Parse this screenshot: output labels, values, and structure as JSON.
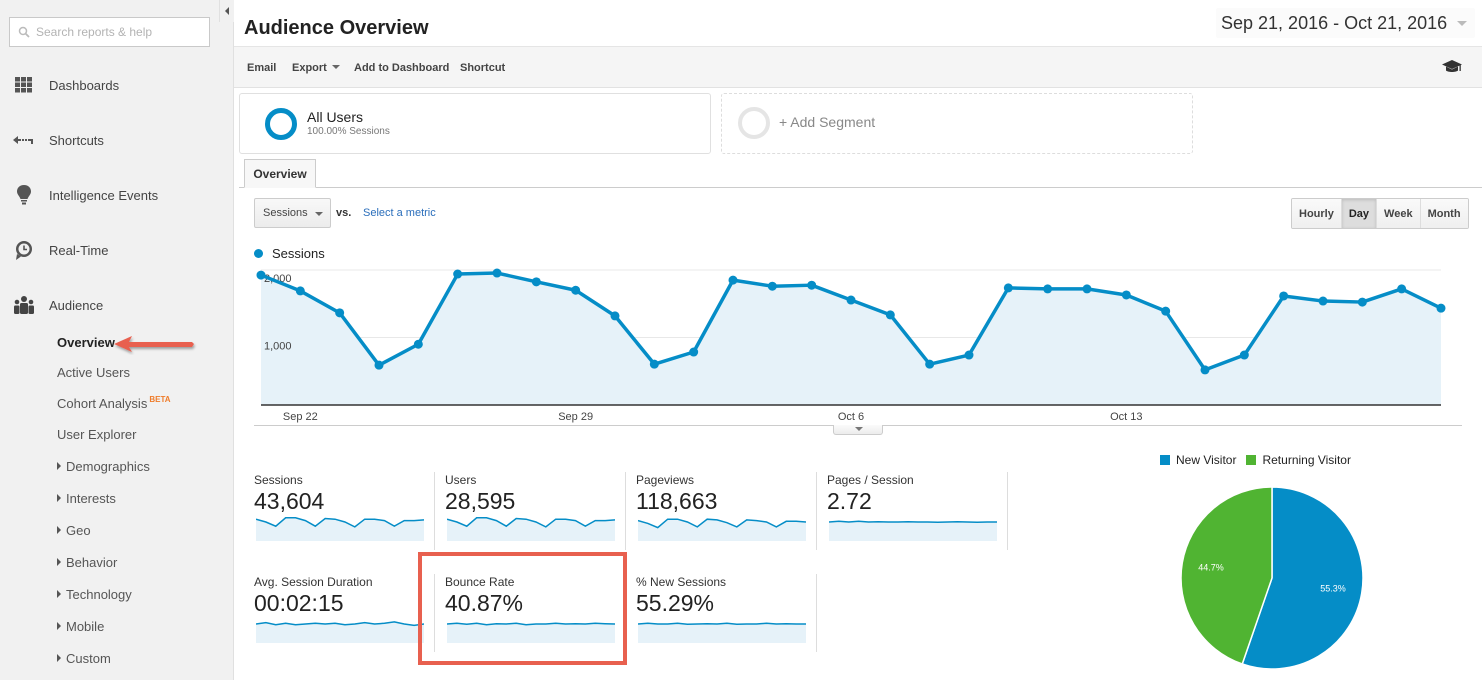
{
  "sidebar": {
    "search_placeholder": "Search reports & help",
    "nav": [
      {
        "label": "Dashboards",
        "icon": "dashboard-grid-icon"
      },
      {
        "label": "Shortcuts",
        "icon": "shortcut-arrow-icon"
      },
      {
        "label": "Intelligence Events",
        "icon": "lightbulb-icon"
      },
      {
        "label": "Real-Time",
        "icon": "clock-icon"
      },
      {
        "label": "Audience",
        "icon": "people-icon"
      }
    ],
    "audience_sub": [
      {
        "label": "Overview",
        "active": true,
        "expandable": false
      },
      {
        "label": "Active Users",
        "expandable": false
      },
      {
        "label": "Cohort Analysis",
        "badge": "BETA",
        "expandable": false
      },
      {
        "label": "User Explorer",
        "expandable": false
      },
      {
        "label": "Demographics",
        "expandable": true
      },
      {
        "label": "Interests",
        "expandable": true
      },
      {
        "label": "Geo",
        "expandable": true
      },
      {
        "label": "Behavior",
        "expandable": true
      },
      {
        "label": "Technology",
        "expandable": true
      },
      {
        "label": "Mobile",
        "expandable": true
      },
      {
        "label": "Custom",
        "expandable": true
      }
    ]
  },
  "header": {
    "title": "Audience Overview",
    "date_range": "Sep 21, 2016 - Oct 21, 2016"
  },
  "toolbar": {
    "email": "Email",
    "export": "Export",
    "add_to_dashboard": "Add to Dashboard",
    "shortcut": "Shortcut"
  },
  "segments": {
    "active": {
      "name": "All Users",
      "sub": "100.00% Sessions"
    },
    "add": "+ Add Segment"
  },
  "tabs": {
    "overview": "Overview"
  },
  "controls": {
    "metric": "Sessions",
    "vs": "vs.",
    "select_metric": "Select a metric",
    "granularity": [
      "Hourly",
      "Day",
      "Week",
      "Month"
    ],
    "granularity_active": "Day"
  },
  "colors": {
    "accent": "#058dc7",
    "area_fill": "#e6f2f9",
    "returning": "#50b432",
    "highlight": "#e8604f"
  },
  "chart_data": {
    "type": "area",
    "title": "",
    "series": [
      {
        "name": "Sessions",
        "values": [
          1925,
          1690,
          1365,
          590,
          900,
          1940,
          1955,
          1825,
          1700,
          1320,
          605,
          785,
          1850,
          1760,
          1775,
          1555,
          1335,
          605,
          740,
          1735,
          1720,
          1720,
          1630,
          1390,
          520,
          740,
          1615,
          1540,
          1525,
          1720,
          1435
        ]
      }
    ],
    "x_start": "Sep 21",
    "x_ticks": [
      {
        "label": "Sep 22",
        "index": 1
      },
      {
        "label": "Sep 29",
        "index": 8
      },
      {
        "label": "Oct 6",
        "index": 15
      },
      {
        "label": "Oct 13",
        "index": 22
      }
    ],
    "y_ticks": [
      {
        "label": "1,000",
        "value": 1000
      },
      {
        "label": "2,000",
        "value": 2000
      }
    ],
    "ylim": [
      0,
      2000
    ],
    "xlabel": "",
    "ylabel": "",
    "grid": true,
    "legend": "top-left"
  },
  "scorecards": [
    {
      "label": "Sessions",
      "value": "43,604",
      "spark": [
        0.7,
        0.5,
        0.2,
        0.8,
        0.8,
        0.6,
        0.2,
        0.75,
        0.7,
        0.5,
        0.15,
        0.7,
        0.7,
        0.6,
        0.2,
        0.6,
        0.6,
        0.65
      ]
    },
    {
      "label": "Users",
      "value": "28,595",
      "spark": [
        0.7,
        0.5,
        0.2,
        0.8,
        0.8,
        0.6,
        0.2,
        0.75,
        0.7,
        0.5,
        0.15,
        0.7,
        0.7,
        0.6,
        0.2,
        0.6,
        0.6,
        0.65
      ]
    },
    {
      "label": "Pageviews",
      "value": "118,663",
      "spark": [
        0.6,
        0.4,
        0.1,
        0.7,
        0.7,
        0.5,
        0.15,
        0.7,
        0.65,
        0.45,
        0.15,
        0.65,
        0.6,
        0.5,
        0.15,
        0.55,
        0.55,
        0.5
      ]
    },
    {
      "label": "Pages / Session",
      "value": "2.72",
      "spark": [
        0.5,
        0.55,
        0.5,
        0.55,
        0.5,
        0.52,
        0.5,
        0.5,
        0.52,
        0.5,
        0.5,
        0.48,
        0.5,
        0.52,
        0.5,
        0.48,
        0.5,
        0.5
      ]
    },
    {
      "label": "Avg. Session Duration",
      "value": "00:02:15",
      "spark": [
        0.5,
        0.6,
        0.45,
        0.55,
        0.45,
        0.5,
        0.55,
        0.5,
        0.55,
        0.45,
        0.5,
        0.6,
        0.5,
        0.55,
        0.65,
        0.5,
        0.4,
        0.5
      ]
    },
    {
      "label": "Bounce Rate",
      "value": "40.87%",
      "spark": [
        0.5,
        0.55,
        0.48,
        0.55,
        0.45,
        0.52,
        0.5,
        0.55,
        0.45,
        0.5,
        0.5,
        0.55,
        0.5,
        0.52,
        0.5,
        0.55,
        0.52,
        0.5
      ]
    },
    {
      "label": "% New Sessions",
      "value": "55.29%",
      "spark": [
        0.5,
        0.55,
        0.5,
        0.5,
        0.55,
        0.48,
        0.5,
        0.52,
        0.5,
        0.55,
        0.48,
        0.5,
        0.5,
        0.55,
        0.5,
        0.52,
        0.5,
        0.5
      ]
    }
  ],
  "pie": {
    "type": "pie",
    "legend": [
      "New Visitor",
      "Returning Visitor"
    ],
    "slices": [
      {
        "label": "New Visitor",
        "value": 55.3,
        "text": "55.3%",
        "color": "#058dc7"
      },
      {
        "label": "Returning Visitor",
        "value": 44.7,
        "text": "44.7%",
        "color": "#50b432"
      }
    ]
  }
}
